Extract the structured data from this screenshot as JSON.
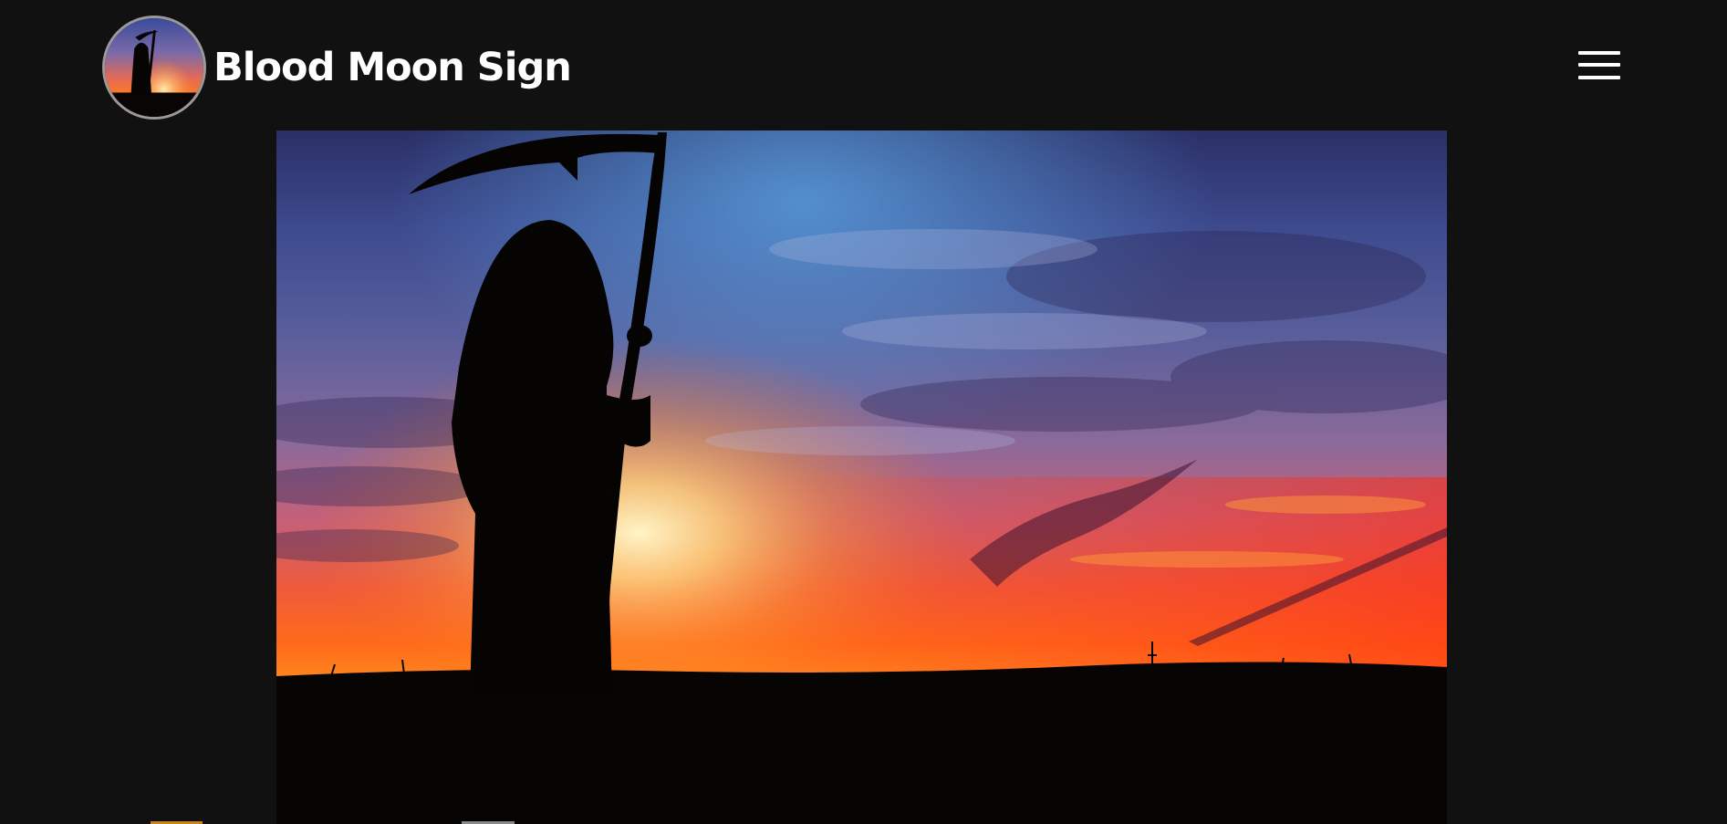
{
  "site": {
    "title": "Blood Moon Sign",
    "logo_icon": "grim-reaper-sunset-logo"
  },
  "header": {
    "menu_icon": "hamburger-menu-icon"
  },
  "hero": {
    "image_subject": "grim-reaper-silhouette-sunset"
  },
  "colors": {
    "background": "#111111",
    "title_text": "#ffffff",
    "sky_top": "#3a3f7a",
    "sky_mid": "#b8577a",
    "sunset_orange": "#ff6a1a",
    "horizon_glow": "#ffd27a",
    "ground": "#050303"
  }
}
